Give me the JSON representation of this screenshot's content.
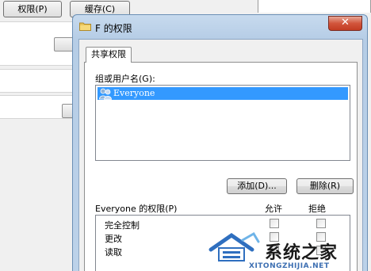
{
  "background_window": {
    "perm_button": "权限(P)",
    "cache_button": "缓存(C)"
  },
  "dialog": {
    "title": "F 的权限",
    "close_glyph": "✕",
    "tab_label": "共享权限",
    "group_label": "组或用户名(G):",
    "group_items": [
      "Everyone"
    ],
    "add_button": "添加(D)...",
    "remove_button": "删除(R)",
    "permissions_header": "Everyone 的权限(P)",
    "allow_header": "允许",
    "deny_header": "拒绝",
    "permissions": [
      {
        "name": "完全控制",
        "allow": false,
        "deny": false
      },
      {
        "name": "更改",
        "allow": false,
        "deny": false
      },
      {
        "name": "读取",
        "allow": true,
        "deny": false
      }
    ]
  },
  "watermark": {
    "text": "系统之家",
    "url": "XITONGZHIJIA.NET"
  },
  "icons": {
    "folder": "folder-icon",
    "users": "users-group-icon",
    "close": "close-icon",
    "check": "✓"
  },
  "colors": {
    "selection": "#3399ff",
    "title_bar": "#bcd2e9",
    "close_button": "#c94a30",
    "watermark_url": "#3d6fb2"
  }
}
